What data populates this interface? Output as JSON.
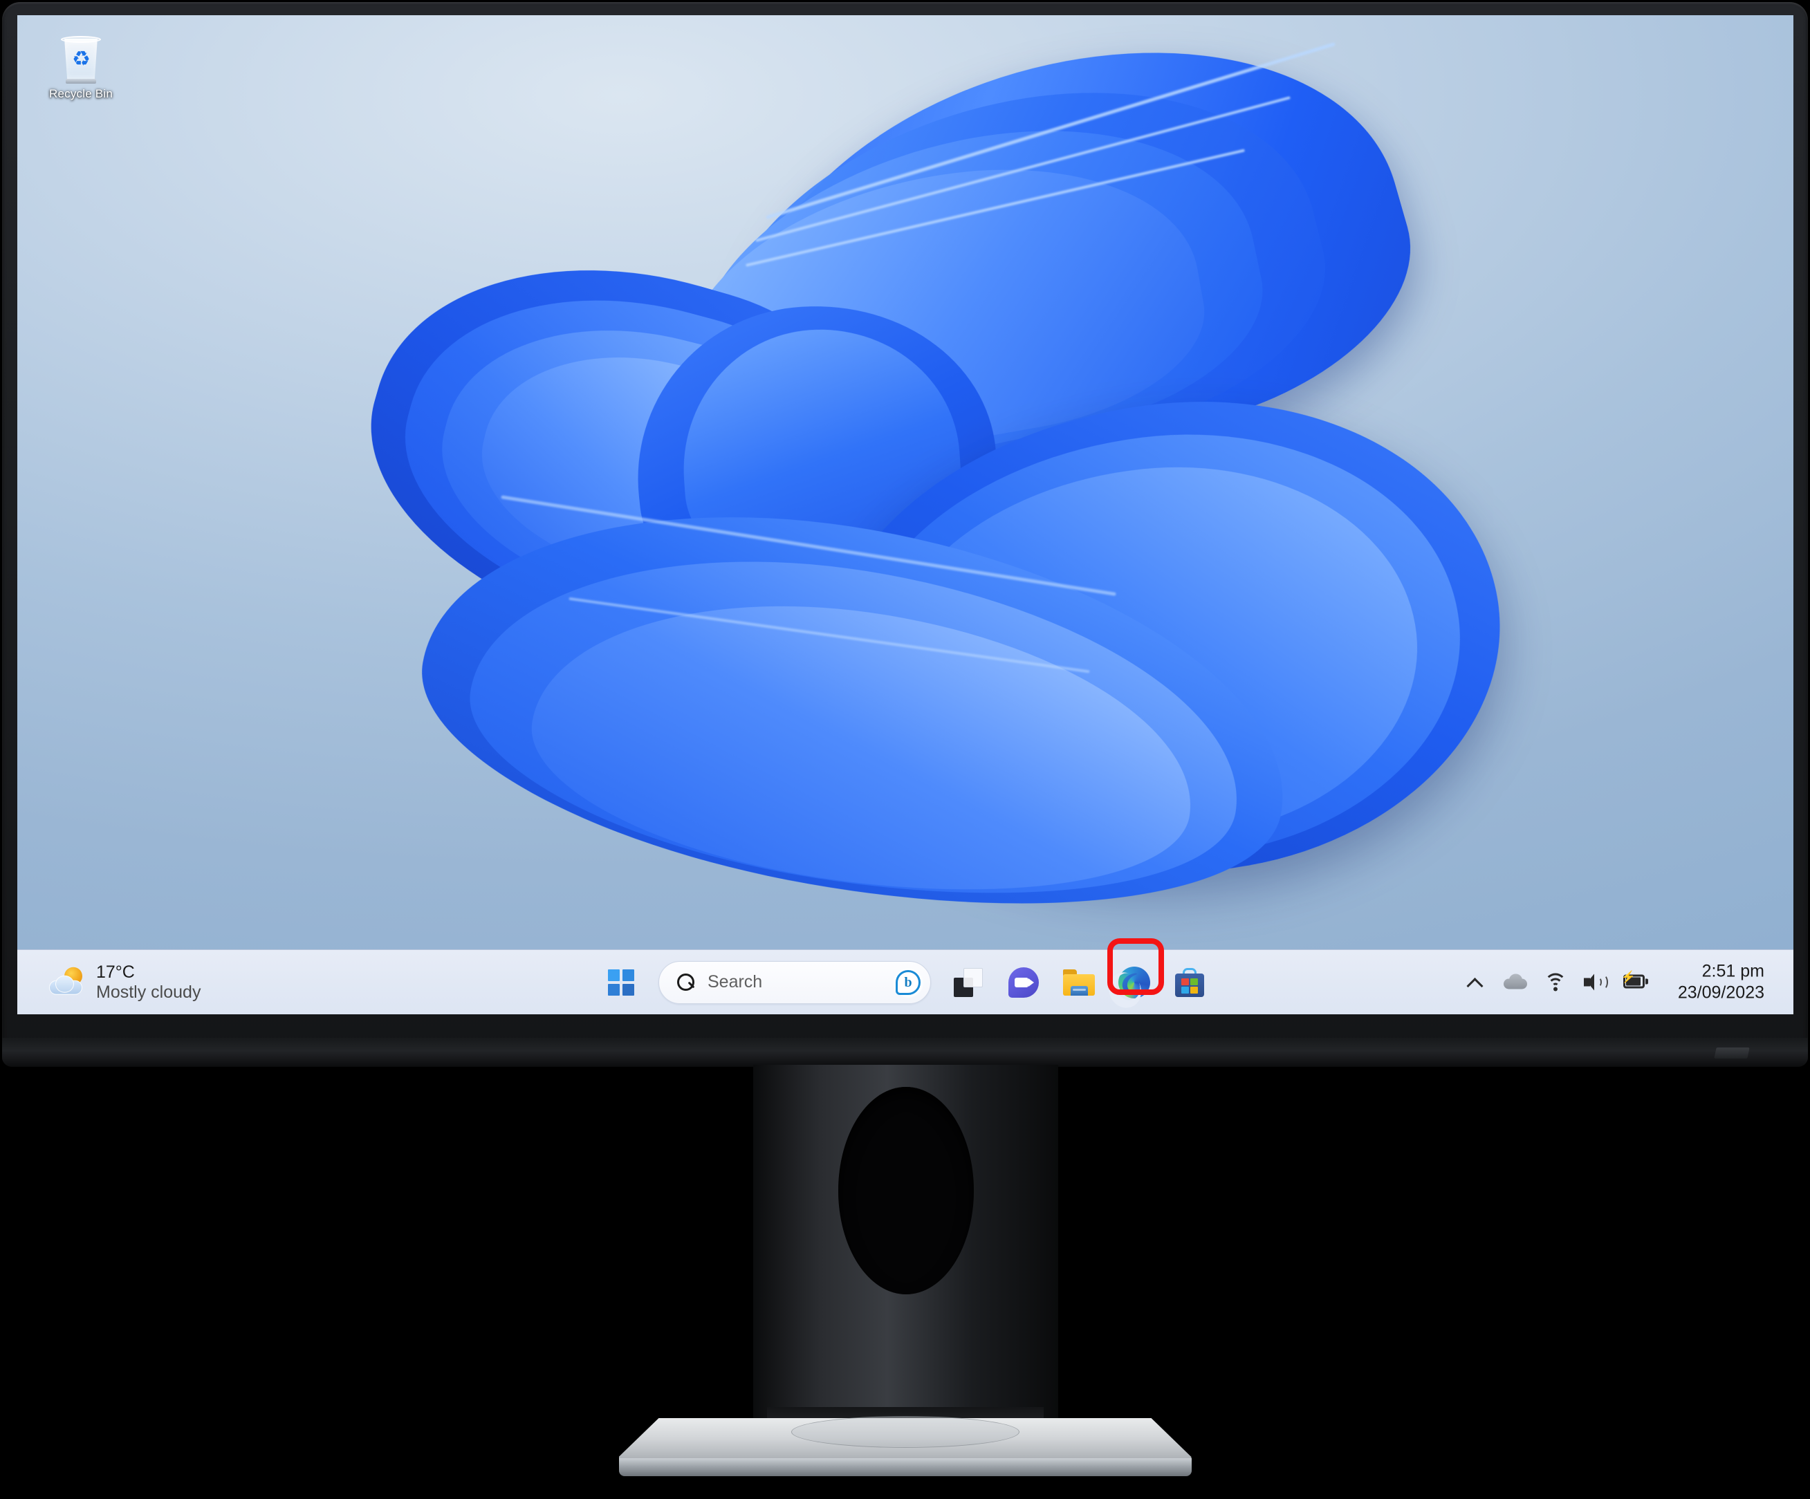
{
  "desktop": {
    "icons": [
      {
        "label": "Recycle Bin",
        "icon": "recycle-bin-icon"
      }
    ]
  },
  "taskbar": {
    "weather": {
      "icon": "partly-cloudy-icon",
      "temperature": "17°C",
      "condition": "Mostly cloudy"
    },
    "start": {
      "label": "Start",
      "icon": "windows-logo-icon"
    },
    "search": {
      "placeholder": "Search",
      "value": "",
      "icon": "search-icon",
      "bing_icon": "bing-chat-icon"
    },
    "pinned": [
      {
        "name": "Task View",
        "icon": "task-view-icon"
      },
      {
        "name": "Chat",
        "icon": "teams-chat-icon"
      },
      {
        "name": "File Explorer",
        "icon": "file-explorer-icon"
      },
      {
        "name": "Microsoft Edge",
        "icon": "edge-icon",
        "highlighted": true
      },
      {
        "name": "Microsoft Store",
        "icon": "microsoft-store-icon"
      }
    ],
    "tray": [
      {
        "name": "Show hidden icons",
        "icon": "chevron-up-icon"
      },
      {
        "name": "OneDrive",
        "icon": "cloud-icon"
      },
      {
        "name": "Network",
        "icon": "wifi-icon"
      },
      {
        "name": "Volume",
        "icon": "speaker-icon"
      },
      {
        "name": "Battery charging",
        "icon": "battery-charging-icon"
      }
    ],
    "clock": {
      "time": "2:51 pm",
      "date": "23/09/2023"
    }
  },
  "annotation": {
    "target": "Microsoft Edge",
    "shape": "rounded-rectangle",
    "color": "#f41414"
  },
  "colors": {
    "taskbar_bg": "#e3e9f5",
    "wallpaper_bg": "#a8c1db",
    "bloom_blue": "#1f5ef5",
    "accent": "#2f7fd6",
    "annotation_red": "#f41414",
    "bezel": "#1d1f22",
    "base_silver": "#c9ced3"
  }
}
